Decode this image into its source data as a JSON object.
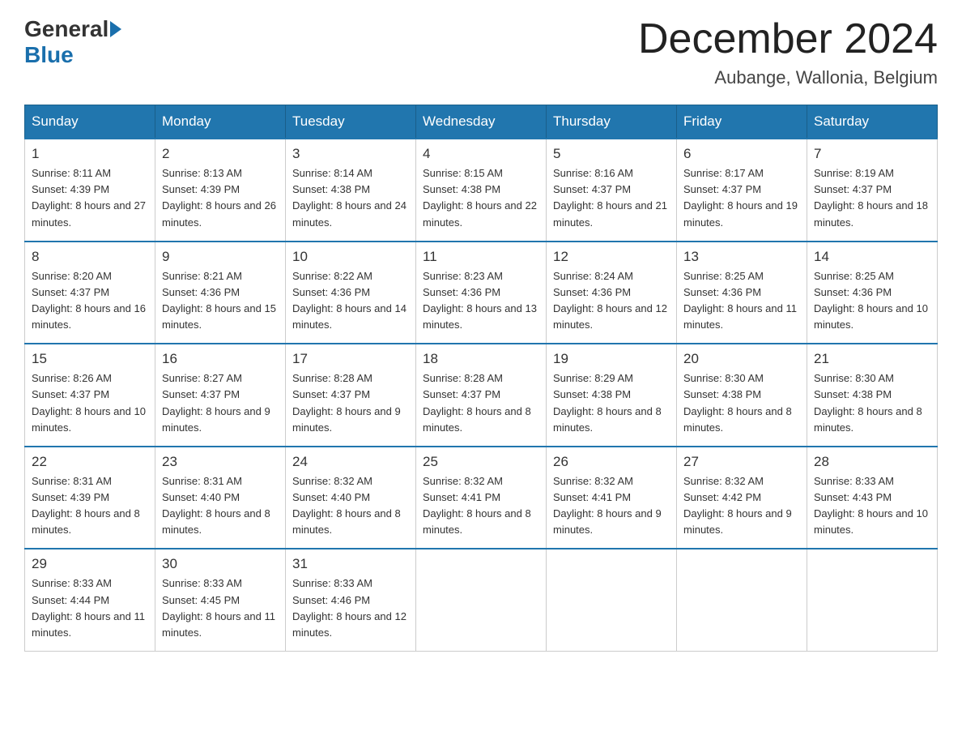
{
  "logo": {
    "general": "General",
    "blue": "Blue"
  },
  "title": "December 2024",
  "subtitle": "Aubange, Wallonia, Belgium",
  "headers": [
    "Sunday",
    "Monday",
    "Tuesday",
    "Wednesday",
    "Thursday",
    "Friday",
    "Saturday"
  ],
  "weeks": [
    [
      {
        "day": "1",
        "sunrise": "8:11 AM",
        "sunset": "4:39 PM",
        "daylight": "8 hours and 27 minutes."
      },
      {
        "day": "2",
        "sunrise": "8:13 AM",
        "sunset": "4:39 PM",
        "daylight": "8 hours and 26 minutes."
      },
      {
        "day": "3",
        "sunrise": "8:14 AM",
        "sunset": "4:38 PM",
        "daylight": "8 hours and 24 minutes."
      },
      {
        "day": "4",
        "sunrise": "8:15 AM",
        "sunset": "4:38 PM",
        "daylight": "8 hours and 22 minutes."
      },
      {
        "day": "5",
        "sunrise": "8:16 AM",
        "sunset": "4:37 PM",
        "daylight": "8 hours and 21 minutes."
      },
      {
        "day": "6",
        "sunrise": "8:17 AM",
        "sunset": "4:37 PM",
        "daylight": "8 hours and 19 minutes."
      },
      {
        "day": "7",
        "sunrise": "8:19 AM",
        "sunset": "4:37 PM",
        "daylight": "8 hours and 18 minutes."
      }
    ],
    [
      {
        "day": "8",
        "sunrise": "8:20 AM",
        "sunset": "4:37 PM",
        "daylight": "8 hours and 16 minutes."
      },
      {
        "day": "9",
        "sunrise": "8:21 AM",
        "sunset": "4:36 PM",
        "daylight": "8 hours and 15 minutes."
      },
      {
        "day": "10",
        "sunrise": "8:22 AM",
        "sunset": "4:36 PM",
        "daylight": "8 hours and 14 minutes."
      },
      {
        "day": "11",
        "sunrise": "8:23 AM",
        "sunset": "4:36 PM",
        "daylight": "8 hours and 13 minutes."
      },
      {
        "day": "12",
        "sunrise": "8:24 AM",
        "sunset": "4:36 PM",
        "daylight": "8 hours and 12 minutes."
      },
      {
        "day": "13",
        "sunrise": "8:25 AM",
        "sunset": "4:36 PM",
        "daylight": "8 hours and 11 minutes."
      },
      {
        "day": "14",
        "sunrise": "8:25 AM",
        "sunset": "4:36 PM",
        "daylight": "8 hours and 10 minutes."
      }
    ],
    [
      {
        "day": "15",
        "sunrise": "8:26 AM",
        "sunset": "4:37 PM",
        "daylight": "8 hours and 10 minutes."
      },
      {
        "day": "16",
        "sunrise": "8:27 AM",
        "sunset": "4:37 PM",
        "daylight": "8 hours and 9 minutes."
      },
      {
        "day": "17",
        "sunrise": "8:28 AM",
        "sunset": "4:37 PM",
        "daylight": "8 hours and 9 minutes."
      },
      {
        "day": "18",
        "sunrise": "8:28 AM",
        "sunset": "4:37 PM",
        "daylight": "8 hours and 8 minutes."
      },
      {
        "day": "19",
        "sunrise": "8:29 AM",
        "sunset": "4:38 PM",
        "daylight": "8 hours and 8 minutes."
      },
      {
        "day": "20",
        "sunrise": "8:30 AM",
        "sunset": "4:38 PM",
        "daylight": "8 hours and 8 minutes."
      },
      {
        "day": "21",
        "sunrise": "8:30 AM",
        "sunset": "4:38 PM",
        "daylight": "8 hours and 8 minutes."
      }
    ],
    [
      {
        "day": "22",
        "sunrise": "8:31 AM",
        "sunset": "4:39 PM",
        "daylight": "8 hours and 8 minutes."
      },
      {
        "day": "23",
        "sunrise": "8:31 AM",
        "sunset": "4:40 PM",
        "daylight": "8 hours and 8 minutes."
      },
      {
        "day": "24",
        "sunrise": "8:32 AM",
        "sunset": "4:40 PM",
        "daylight": "8 hours and 8 minutes."
      },
      {
        "day": "25",
        "sunrise": "8:32 AM",
        "sunset": "4:41 PM",
        "daylight": "8 hours and 8 minutes."
      },
      {
        "day": "26",
        "sunrise": "8:32 AM",
        "sunset": "4:41 PM",
        "daylight": "8 hours and 9 minutes."
      },
      {
        "day": "27",
        "sunrise": "8:32 AM",
        "sunset": "4:42 PM",
        "daylight": "8 hours and 9 minutes."
      },
      {
        "day": "28",
        "sunrise": "8:33 AM",
        "sunset": "4:43 PM",
        "daylight": "8 hours and 10 minutes."
      }
    ],
    [
      {
        "day": "29",
        "sunrise": "8:33 AM",
        "sunset": "4:44 PM",
        "daylight": "8 hours and 11 minutes."
      },
      {
        "day": "30",
        "sunrise": "8:33 AM",
        "sunset": "4:45 PM",
        "daylight": "8 hours and 11 minutes."
      },
      {
        "day": "31",
        "sunrise": "8:33 AM",
        "sunset": "4:46 PM",
        "daylight": "8 hours and 12 minutes."
      },
      null,
      null,
      null,
      null
    ]
  ]
}
